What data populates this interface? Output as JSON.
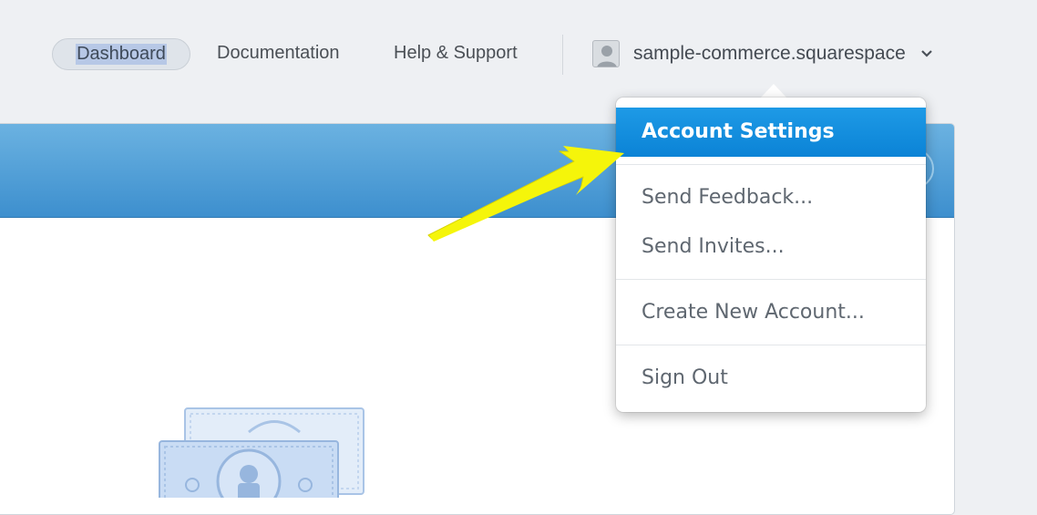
{
  "nav": {
    "dashboard_label": "Dashboard",
    "documentation_label": "Documentation",
    "help_label": "Help & Support",
    "account_name": "sample-commerce.squarespace",
    "avatar_icon": "user-avatar-icon",
    "chevron_icon": "chevron-down-icon"
  },
  "dropdown": {
    "items": [
      {
        "label": "Account Settings",
        "highlighted": true
      },
      {
        "label": "Send Feedback..."
      },
      {
        "label": "Send Invites..."
      },
      {
        "label": "Create New Account..."
      },
      {
        "label": "Sign Out"
      }
    ]
  },
  "colors": {
    "accent": "#0b83d6",
    "header_blue": "#3d8fce",
    "annotation_arrow": "#f5f50a"
  },
  "illustration": {
    "icon": "money-bills-icon"
  }
}
